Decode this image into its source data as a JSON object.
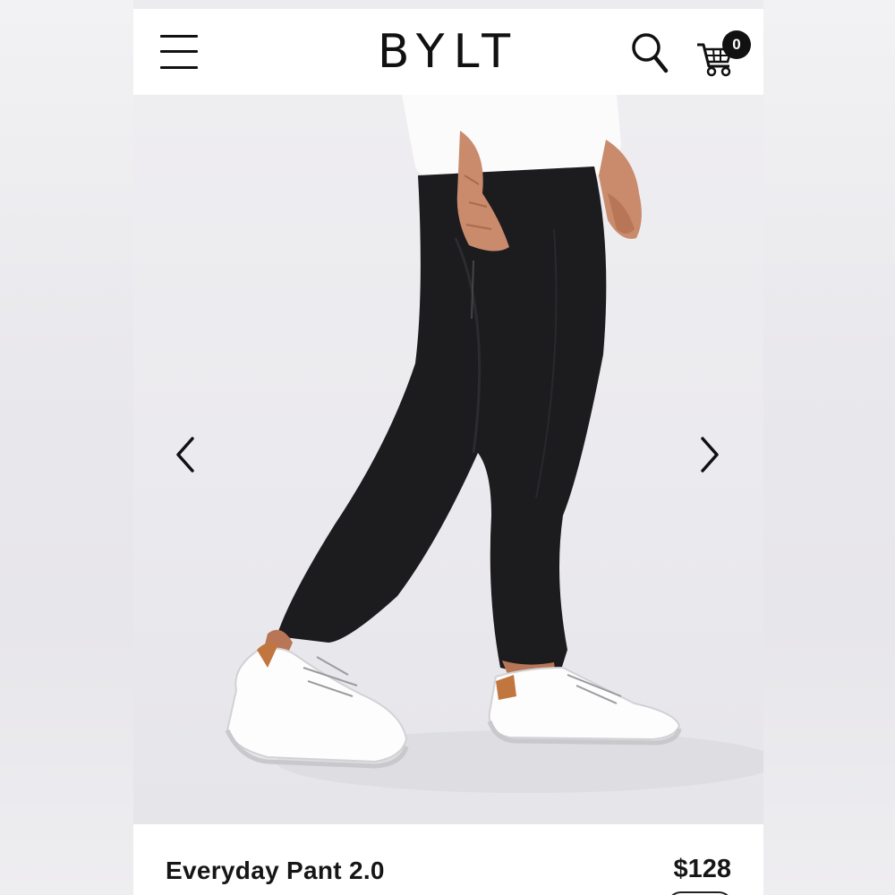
{
  "header": {
    "logo_text": "BYLT",
    "cart_count": "0"
  },
  "icons": {
    "menu": "hamburger-menu-icon",
    "search": "search-icon",
    "cart": "shopping-cart-icon",
    "prev": "chevron-left-icon",
    "next": "chevron-right-icon"
  },
  "product": {
    "name": "Everyday Pant 2.0",
    "price": "$128",
    "rating_stars": "★★★★★"
  },
  "colors": {
    "text": "#161616",
    "background": "#ffffff",
    "badge": "#111111"
  }
}
